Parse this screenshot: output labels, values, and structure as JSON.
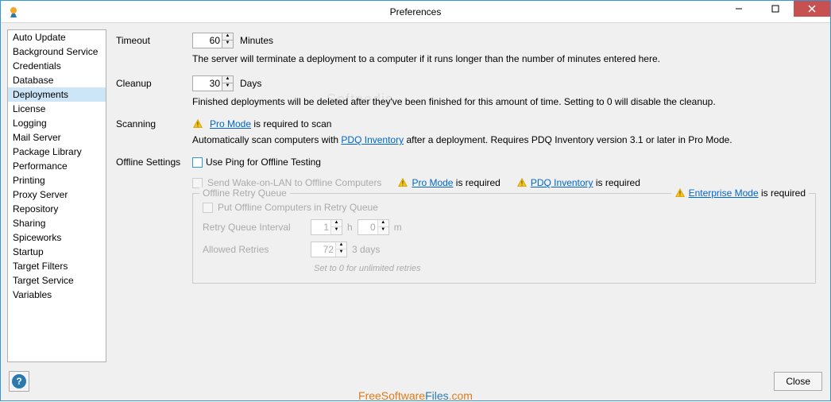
{
  "window": {
    "title": "Preferences"
  },
  "sidebar": {
    "items": [
      {
        "label": "Auto Update"
      },
      {
        "label": "Background Service"
      },
      {
        "label": "Credentials"
      },
      {
        "label": "Database"
      },
      {
        "label": "Deployments",
        "selected": true
      },
      {
        "label": "License"
      },
      {
        "label": "Logging"
      },
      {
        "label": "Mail Server"
      },
      {
        "label": "Package Library"
      },
      {
        "label": "Performance"
      },
      {
        "label": "Printing"
      },
      {
        "label": "Proxy Server"
      },
      {
        "label": "Repository"
      },
      {
        "label": "Sharing"
      },
      {
        "label": "Spiceworks"
      },
      {
        "label": "Startup"
      },
      {
        "label": "Target Filters"
      },
      {
        "label": "Target Service"
      },
      {
        "label": "Variables"
      }
    ]
  },
  "deploy": {
    "timeout_label": "Timeout",
    "timeout_value": "60",
    "timeout_unit": "Minutes",
    "timeout_desc": "The server will terminate a deployment to a computer if it runs longer than the number of minutes entered here.",
    "cleanup_label": "Cleanup",
    "cleanup_value": "30",
    "cleanup_unit": "Days",
    "cleanup_desc": "Finished deployments will be deleted after they've been finished for this amount of time. Setting to 0 will disable the cleanup.",
    "scanning_label": "Scanning",
    "pro_mode": "Pro Mode",
    "req_scan": " is required to scan",
    "scan_desc_pre": "Automatically scan computers with ",
    "pdq_inventory": "PDQ Inventory",
    "scan_desc_post": " after a deployment. Requires PDQ Inventory version 3.1 or later in Pro Mode.",
    "offline_label": "Offline Settings",
    "use_ping": "Use Ping for Offline Testing",
    "wol": "Send Wake-on-LAN to Offline Computers",
    "is_required": " is required",
    "queue_legend": "Offline Retry Queue",
    "enterprise_mode": "Enterprise Mode",
    "put_offline": "Put Offline Computers in Retry Queue",
    "retry_interval_label": "Retry Queue Interval",
    "retry_h": "1",
    "retry_h_unit": "h",
    "retry_m": "0",
    "retry_m_unit": "m",
    "allowed_retries_label": "Allowed Retries",
    "allowed_retries_value": "72",
    "allowed_retries_desc": "3 days",
    "retries_hint": "Set to 0 for unlimited retries"
  },
  "footer": {
    "close": "Close"
  },
  "watermark": {
    "soft": "Softpedia",
    "site1": "FreeSoftware",
    "site2": "Files",
    "site3": ".com"
  }
}
